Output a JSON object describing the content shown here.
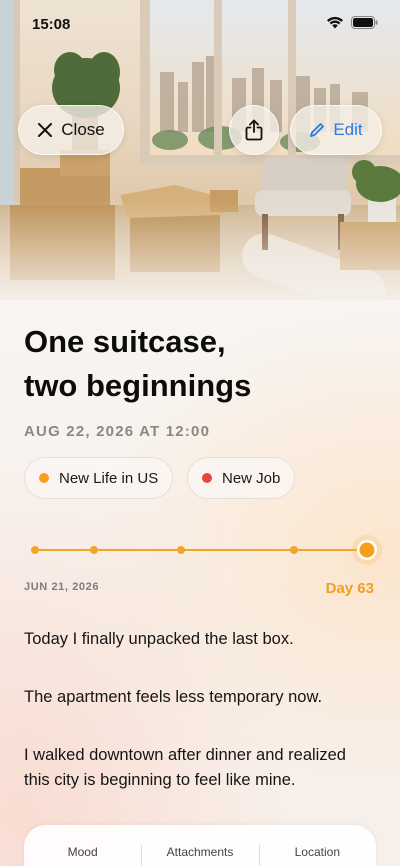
{
  "status_bar": {
    "time": "15:08"
  },
  "toolbar": {
    "close_label": "Close",
    "edit_label": "Edit"
  },
  "entry": {
    "title_line1": "One suitcase,",
    "title_line2": "two beginnings",
    "date": "AUG 22, 2026 AT 12:00",
    "tags": [
      {
        "label": "New Life in US",
        "color": "#f59f1d"
      },
      {
        "label": "New Job",
        "color": "#e84545"
      }
    ],
    "timeline": {
      "start_label": "JUN 21, 2026",
      "day_label": "Day 63",
      "accent": "#f2a52b"
    },
    "paragraphs": [
      "Today I finally unpacked the last box.",
      "The apartment feels less temporary now.",
      "I walked downtown after dinner and realized this city is beginning to feel like mine."
    ]
  },
  "bottom_tabs": [
    "Mood",
    "Attachments",
    "Location"
  ]
}
